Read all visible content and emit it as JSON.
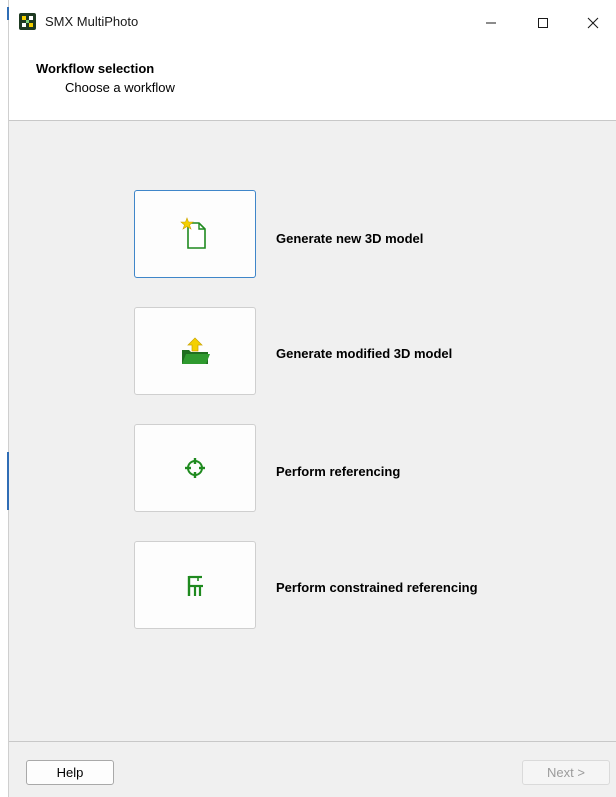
{
  "window": {
    "title": "SMX MultiPhoto",
    "controls": {
      "minimize_icon": "minimize-icon",
      "maximize_icon": "maximize-icon",
      "close_icon": "close-icon"
    }
  },
  "header": {
    "title": "Workflow selection",
    "subtitle": "Choose a workflow"
  },
  "workflows": [
    {
      "label": "Generate new 3D model",
      "icon": "new-document-icon",
      "focused": true
    },
    {
      "label": "Generate modified 3D model",
      "icon": "open-folder-upload-icon",
      "focused": false
    },
    {
      "label": "Perform referencing",
      "icon": "crosshair-target-icon",
      "focused": false
    },
    {
      "label": "Perform constrained referencing",
      "icon": "constrained-reference-icon",
      "focused": false
    }
  ],
  "footer": {
    "help_label": "Help",
    "next_label": "Next >",
    "next_enabled": false
  },
  "colors": {
    "accent_focus": "#3f86c9",
    "icon_green": "#1f8a1f",
    "icon_yellow": "#f4d000",
    "window_bg": "#f0f0f0"
  }
}
